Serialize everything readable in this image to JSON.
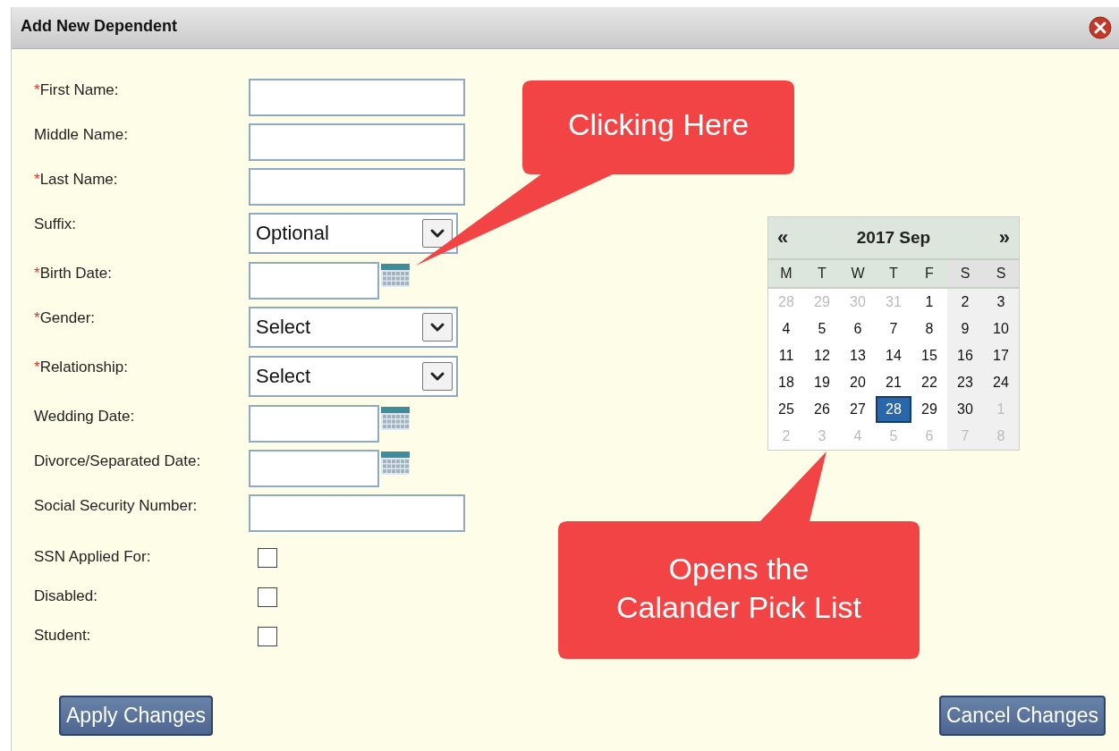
{
  "dialog": {
    "title": "Add New Dependent"
  },
  "fields": [
    {
      "kind": "text",
      "marker": "*",
      "label": "First Name:"
    },
    {
      "kind": "text",
      "label": "Middle Name:"
    },
    {
      "kind": "text",
      "marker": "*",
      "label": "Last Name:"
    },
    {
      "kind": "select",
      "label": "Suffix:",
      "value": "Optional"
    },
    {
      "kind": "date",
      "marker": "*",
      "label": "Birth Date:"
    },
    {
      "kind": "select",
      "marker": "*",
      "label": "Gender:",
      "value": "Select"
    },
    {
      "kind": "select",
      "marker": "*",
      "label": "Relationship:",
      "value": "Select"
    },
    {
      "kind": "date",
      "label": "Wedding Date:"
    },
    {
      "kind": "date",
      "label": "Divorce/Separated Date:"
    },
    {
      "kind": "text",
      "label": "Social Security Number:"
    },
    {
      "kind": "checkbox",
      "label": "SSN Applied For:",
      "checked": false
    },
    {
      "kind": "checkbox",
      "label": "Disabled:",
      "checked": false
    },
    {
      "kind": "checkbox",
      "label": "Student:",
      "checked": false
    }
  ],
  "calendar": {
    "prev": "«",
    "title": "2017 Sep",
    "next": "»",
    "weekdays": [
      "M",
      "T",
      "W",
      "T",
      "F",
      "S",
      "S"
    ],
    "weeks": [
      [
        {
          "day": "28",
          "kind": "other",
          "selected": false
        },
        {
          "day": "29",
          "kind": "other",
          "selected": false
        },
        {
          "day": "30",
          "kind": "other",
          "selected": false
        },
        {
          "day": "31",
          "kind": "other",
          "selected": false
        },
        {
          "day": "1",
          "kind": "current",
          "selected": false
        },
        {
          "day": "2",
          "kind": "current",
          "selected": false
        },
        {
          "day": "3",
          "kind": "current",
          "selected": false
        }
      ],
      [
        {
          "day": "4",
          "kind": "current",
          "selected": false
        },
        {
          "day": "5",
          "kind": "current",
          "selected": false
        },
        {
          "day": "6",
          "kind": "current",
          "selected": false
        },
        {
          "day": "7",
          "kind": "current",
          "selected": false
        },
        {
          "day": "8",
          "kind": "current",
          "selected": false
        },
        {
          "day": "9",
          "kind": "current",
          "selected": false
        },
        {
          "day": "10",
          "kind": "current",
          "selected": false
        }
      ],
      [
        {
          "day": "11",
          "kind": "current",
          "selected": false
        },
        {
          "day": "12",
          "kind": "current",
          "selected": false
        },
        {
          "day": "13",
          "kind": "current",
          "selected": false
        },
        {
          "day": "14",
          "kind": "current",
          "selected": false
        },
        {
          "day": "15",
          "kind": "current",
          "selected": false
        },
        {
          "day": "16",
          "kind": "current",
          "selected": false
        },
        {
          "day": "17",
          "kind": "current",
          "selected": false
        }
      ],
      [
        {
          "day": "18",
          "kind": "current",
          "selected": false
        },
        {
          "day": "19",
          "kind": "current",
          "selected": false
        },
        {
          "day": "20",
          "kind": "current",
          "selected": false
        },
        {
          "day": "21",
          "kind": "current",
          "selected": false
        },
        {
          "day": "22",
          "kind": "current",
          "selected": false
        },
        {
          "day": "23",
          "kind": "current",
          "selected": false
        },
        {
          "day": "24",
          "kind": "current",
          "selected": false
        }
      ],
      [
        {
          "day": "25",
          "kind": "current",
          "selected": false
        },
        {
          "day": "26",
          "kind": "current",
          "selected": false
        },
        {
          "day": "27",
          "kind": "current",
          "selected": false
        },
        {
          "day": "28",
          "kind": "current",
          "selected": true
        },
        {
          "day": "29",
          "kind": "current",
          "selected": false
        },
        {
          "day": "30",
          "kind": "current",
          "selected": false
        },
        {
          "day": "1",
          "kind": "other",
          "selected": false
        }
      ],
      [
        {
          "day": "2",
          "kind": "other",
          "selected": false
        },
        {
          "day": "3",
          "kind": "other",
          "selected": false
        },
        {
          "day": "4",
          "kind": "other",
          "selected": false
        },
        {
          "day": "5",
          "kind": "other",
          "selected": false
        },
        {
          "day": "6",
          "kind": "other",
          "selected": false
        },
        {
          "day": "7",
          "kind": "other",
          "selected": false
        },
        {
          "day": "8",
          "kind": "other",
          "selected": false
        }
      ]
    ]
  },
  "callouts": [
    {
      "text": "Clicking Here",
      "kind": "down-left"
    },
    {
      "text": "Opens the\nCalander Pick List",
      "kind": "up"
    }
  ],
  "buttons": [
    {
      "label": "Apply Changes"
    },
    {
      "label": "Cancel Changes"
    }
  ]
}
